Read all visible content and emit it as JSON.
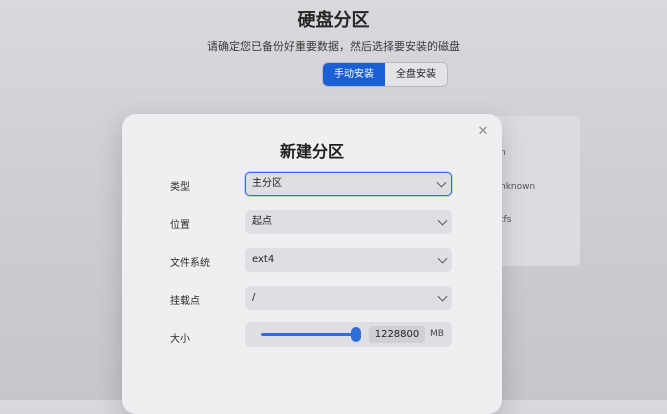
{
  "background": {
    "title": "硬盘分区",
    "subtitle": "请确定您已备份好重要数据，然后选择要安装的磁盘",
    "tabs": [
      {
        "label": "手动安装",
        "active": true
      },
      {
        "label": "全盘安装",
        "active": false
      }
    ],
    "fragments": [
      "n",
      "nknown",
      "tfs"
    ]
  },
  "dialog": {
    "title": "新建分区",
    "close_icon": "close-icon",
    "fields": {
      "type": {
        "label": "类型",
        "value": "主分区"
      },
      "location": {
        "label": "位置",
        "value": "起点"
      },
      "filesystem": {
        "label": "文件系统",
        "value": "ext4"
      },
      "mount": {
        "label": "挂载点",
        "value": "/"
      },
      "size": {
        "label": "大小",
        "value": "1228800",
        "unit": "MB",
        "slider_fraction": 1.0
      }
    }
  },
  "colors": {
    "accent": "#1a5fd4",
    "focus": "#2e6fd9"
  }
}
